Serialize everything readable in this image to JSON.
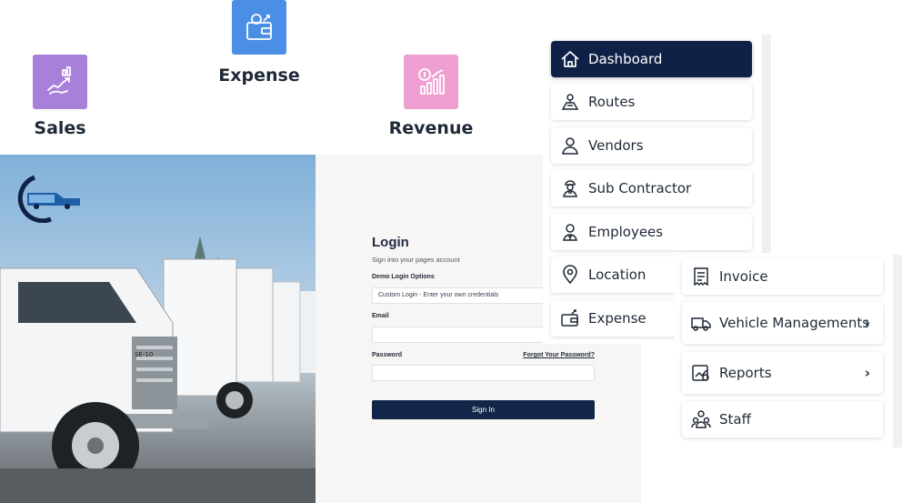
{
  "tiles": [
    {
      "label": "Sales",
      "icon": "sales-growth-icon",
      "color": "#a680d9"
    },
    {
      "label": "Expense",
      "icon": "wallet-icon",
      "color": "#4a8ee6"
    },
    {
      "label": "Revenue",
      "icon": "revenue-chart-icon",
      "color": "#ee9ed0"
    }
  ],
  "login": {
    "title": "Login",
    "subtitle": "Sign into your pages account",
    "demo_label": "Demo Login Options",
    "demo_value": "Custom Login - Enter your own credentials",
    "email_label": "Email",
    "email_value": "",
    "password_label": "Password",
    "password_value": "",
    "forgot_link": "Forgot Your Password?",
    "signin_button": "Sign In",
    "truck_number": "SE-10"
  },
  "menu_primary": [
    {
      "label": "Dashboard",
      "icon": "home-icon",
      "active": true
    },
    {
      "label": "Routes",
      "icon": "routes-icon"
    },
    {
      "label": "Vendors",
      "icon": "user-icon"
    },
    {
      "label": "Sub Contractor",
      "icon": "worker-icon"
    },
    {
      "label": "Employees",
      "icon": "employee-icon"
    },
    {
      "label": "Location",
      "icon": "location-pin-icon"
    },
    {
      "label": "Expense",
      "icon": "wallet-icon"
    }
  ],
  "menu_secondary": [
    {
      "label": "Invoice",
      "icon": "invoice-icon"
    },
    {
      "label": "Vehicle Managements",
      "icon": "truck-icon",
      "chevron": "›"
    },
    {
      "label": "Reports",
      "icon": "report-icon",
      "chevron": "›"
    },
    {
      "label": "Staff",
      "icon": "staff-icon"
    }
  ],
  "colors": {
    "accent": "#0f2147",
    "signin": "#12264a"
  }
}
